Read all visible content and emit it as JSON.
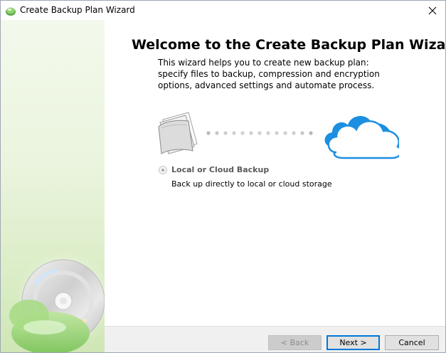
{
  "window": {
    "title": "Create Backup Plan Wizard",
    "close_glyph": "✕",
    "app_icon": "backup-app-icon"
  },
  "page": {
    "heading": "Welcome to the Create Backup Plan Wizard",
    "description": "This wizard helps you to create new backup plan: specify files to backup, compression and encryption options, advanced settings and automate process."
  },
  "illustration": {
    "source_icon": "documents-icon",
    "target_icon": "cloud-icon",
    "dot_count": 13
  },
  "options": [
    {
      "title": "Local or Cloud Backup",
      "subtitle": "Back up directly to local or cloud storage",
      "selected": true
    }
  ],
  "buttons": {
    "back": "< Back",
    "next": "Next >",
    "cancel": "Cancel"
  },
  "colors": {
    "accent": "#0078d7",
    "cloud": "#1c8fe0",
    "sidebar_green": "#cfe6b6"
  }
}
